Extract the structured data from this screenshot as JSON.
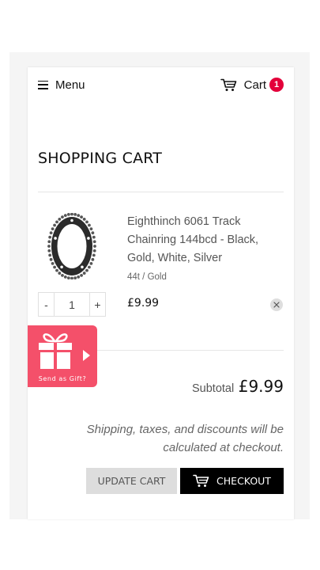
{
  "colors": {
    "badge": "#e3003a",
    "checkout_button": "#000000",
    "update_button": "#dddddd",
    "gift_widget": "#f4506a"
  },
  "header": {
    "menu_label": "Menu",
    "menu_icon": "hamburger-icon",
    "cart_label": "Cart",
    "cart_icon": "cart-icon",
    "cart_count": "1"
  },
  "page": {
    "title": "SHOPPING CART"
  },
  "cart": {
    "items": [
      {
        "name": "Eighthinch 6061 Track Chainring 144bcd - Black, Gold, White, Silver",
        "variant": "44t / Gold",
        "quantity": "1",
        "decrement_label": "-",
        "increment_label": "+",
        "price": "£9.99",
        "image_icon": "chainring-image",
        "remove_icon": "close-icon"
      }
    ],
    "subtotal_label": "Subtotal",
    "subtotal_value": "£9.99",
    "note": "Shipping, taxes, and discounts will be calculated at checkout.",
    "update_label": "UPDATE CART",
    "checkout_label": "CHECKOUT"
  },
  "gift_widget": {
    "label": "Send as Gift?",
    "icon": "gift-icon"
  }
}
